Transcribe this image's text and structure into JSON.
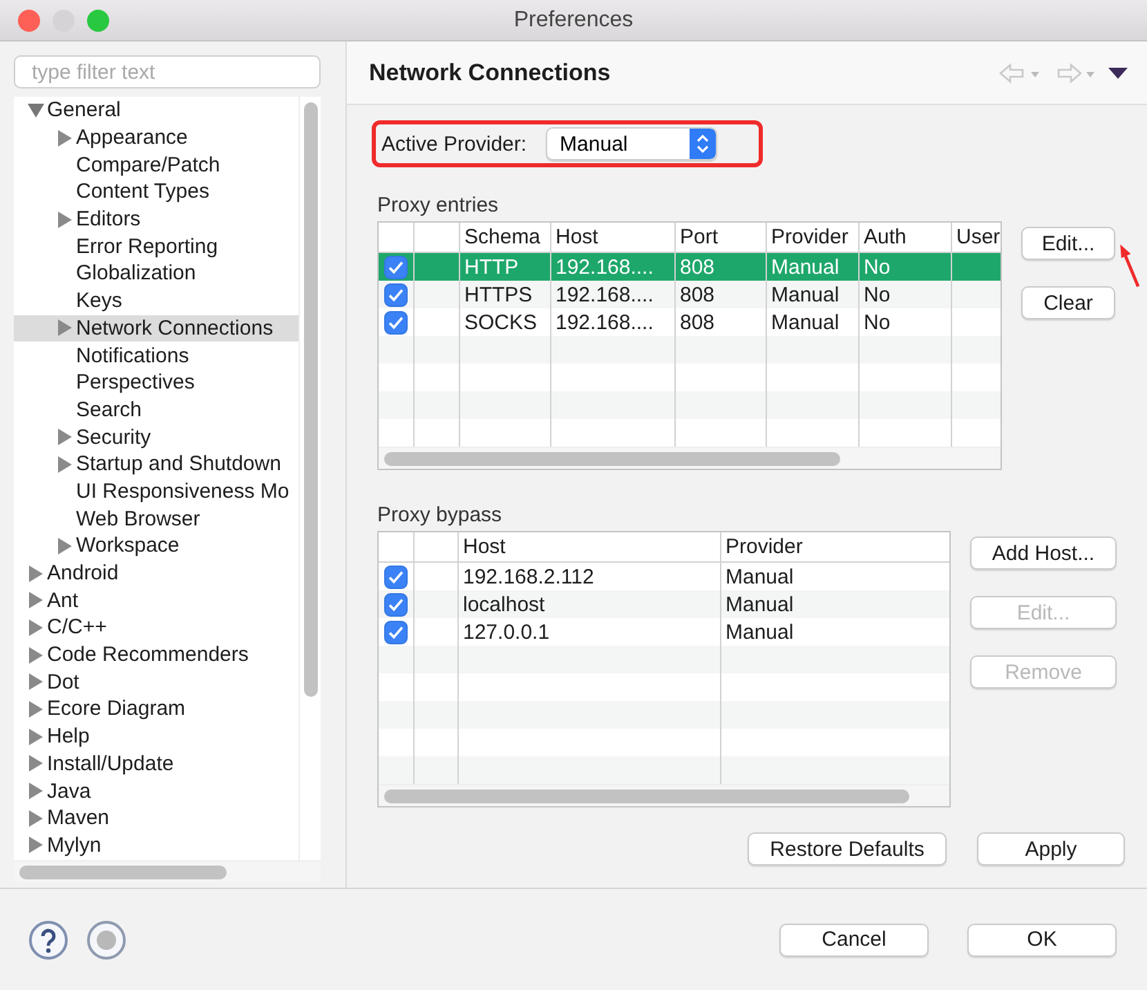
{
  "window": {
    "title": "Preferences"
  },
  "filter": {
    "placeholder": "type filter text"
  },
  "tree": [
    {
      "label": "General",
      "kind": "folder",
      "expanded": true,
      "selected": false,
      "children": [
        {
          "label": "Appearance",
          "kind": "folder",
          "expanded": false,
          "selected": false
        },
        {
          "label": "Compare/Patch",
          "kind": "leaf",
          "selected": false
        },
        {
          "label": "Content Types",
          "kind": "leaf",
          "selected": false
        },
        {
          "label": "Editors",
          "kind": "folder",
          "expanded": false,
          "selected": false
        },
        {
          "label": "Error Reporting",
          "kind": "leaf",
          "selected": false
        },
        {
          "label": "Globalization",
          "kind": "leaf",
          "selected": false
        },
        {
          "label": "Keys",
          "kind": "leaf",
          "selected": false
        },
        {
          "label": "Network Connections",
          "kind": "folder",
          "expanded": false,
          "selected": true
        },
        {
          "label": "Notifications",
          "kind": "leaf",
          "selected": false
        },
        {
          "label": "Perspectives",
          "kind": "leaf",
          "selected": false
        },
        {
          "label": "Search",
          "kind": "leaf",
          "selected": false
        },
        {
          "label": "Security",
          "kind": "folder",
          "expanded": false,
          "selected": false
        },
        {
          "label": "Startup and Shutdown",
          "kind": "folder",
          "expanded": false,
          "selected": false
        },
        {
          "label": "UI Responsiveness Mo",
          "kind": "leaf",
          "selected": false
        },
        {
          "label": "Web Browser",
          "kind": "leaf",
          "selected": false
        },
        {
          "label": "Workspace",
          "kind": "folder",
          "expanded": false,
          "selected": false
        }
      ]
    },
    {
      "label": "Android",
      "kind": "folder",
      "expanded": false,
      "selected": false
    },
    {
      "label": "Ant",
      "kind": "folder",
      "expanded": false,
      "selected": false
    },
    {
      "label": "C/C++",
      "kind": "folder",
      "expanded": false,
      "selected": false
    },
    {
      "label": "Code Recommenders",
      "kind": "folder",
      "expanded": false,
      "selected": false
    },
    {
      "label": "Dot",
      "kind": "folder",
      "expanded": false,
      "selected": false
    },
    {
      "label": "Ecore Diagram",
      "kind": "folder",
      "expanded": false,
      "selected": false
    },
    {
      "label": "Help",
      "kind": "folder",
      "expanded": false,
      "selected": false
    },
    {
      "label": "Install/Update",
      "kind": "folder",
      "expanded": false,
      "selected": false
    },
    {
      "label": "Java",
      "kind": "folder",
      "expanded": false,
      "selected": false
    },
    {
      "label": "Maven",
      "kind": "folder",
      "expanded": false,
      "selected": false
    },
    {
      "label": "Mylyn",
      "kind": "folder",
      "expanded": false,
      "selected": false
    }
  ],
  "page_title": "Network Connections",
  "active_provider": {
    "label": "Active Provider:",
    "value": "Manual",
    "highlighted": true
  },
  "proxy_entries": {
    "label": "Proxy entries",
    "columns": [
      "Schema",
      "Host",
      "Port",
      "Provider",
      "Auth",
      "User"
    ],
    "rows": [
      {
        "checked": true,
        "selected": true,
        "cells": [
          "HTTP",
          "192.168....",
          "808",
          "Manual",
          "No"
        ]
      },
      {
        "checked": true,
        "selected": false,
        "cells": [
          "HTTPS",
          "192.168....",
          "808",
          "Manual",
          "No"
        ]
      },
      {
        "checked": true,
        "selected": false,
        "cells": [
          "SOCKS",
          "192.168....",
          "808",
          "Manual",
          "No"
        ]
      }
    ],
    "buttons": [
      {
        "label": "Edit...",
        "disabled": false,
        "arrow": true
      },
      {
        "label": "Clear",
        "disabled": false,
        "arrow": false
      }
    ]
  },
  "proxy_bypass": {
    "label": "Proxy bypass",
    "columns": [
      "Host",
      "Provider"
    ],
    "rows": [
      {
        "checked": true,
        "cells": [
          "192.168.2.112",
          "Manual"
        ]
      },
      {
        "checked": true,
        "cells": [
          "localhost",
          "Manual"
        ]
      },
      {
        "checked": true,
        "cells": [
          "127.0.0.1",
          "Manual"
        ]
      }
    ],
    "buttons": [
      {
        "label": "Add Host...",
        "disabled": false
      },
      {
        "label": "Edit...",
        "disabled": true
      },
      {
        "label": "Remove",
        "disabled": true
      }
    ]
  },
  "page_buttons": [
    "Restore Defaults",
    "Apply"
  ],
  "dialog_buttons": [
    "Cancel",
    "OK"
  ]
}
